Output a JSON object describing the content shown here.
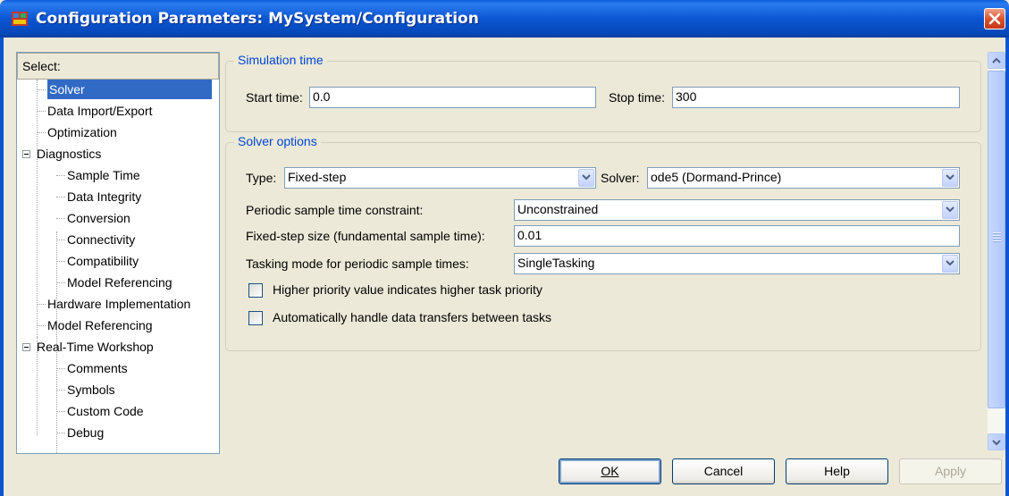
{
  "window": {
    "title": "Configuration Parameters: MySystem/Configuration",
    "colors": {
      "titlebar": "#0a55d2",
      "accent": "#316ac5",
      "group_title": "#0046d5"
    }
  },
  "tree": {
    "header": "Select:",
    "items": [
      {
        "label": "Solver",
        "selected": true
      },
      {
        "label": "Data Import/Export"
      },
      {
        "label": "Optimization"
      },
      {
        "label": "Diagnostics",
        "expanded": true
      },
      {
        "label": "Sample Time"
      },
      {
        "label": "Data Integrity"
      },
      {
        "label": "Conversion"
      },
      {
        "label": "Connectivity"
      },
      {
        "label": "Compatibility"
      },
      {
        "label": "Model Referencing"
      },
      {
        "label": "Hardware Implementation"
      },
      {
        "label": "Model Referencing"
      },
      {
        "label": "Real-Time Workshop",
        "expanded": true
      },
      {
        "label": "Comments"
      },
      {
        "label": "Symbols"
      },
      {
        "label": "Custom Code"
      },
      {
        "label": "Debug"
      }
    ]
  },
  "simulation_time": {
    "title": "Simulation time",
    "start_label": "Start time:",
    "start_value": "0.0",
    "stop_label": "Stop time:",
    "stop_value": "300"
  },
  "solver_options": {
    "title": "Solver options",
    "type_label": "Type:",
    "type_value": "Fixed-step",
    "solver_label": "Solver:",
    "solver_value": "ode5 (Dormand-Prince)",
    "periodic_label": "Periodic sample time constraint:",
    "periodic_value": "Unconstrained",
    "step_label": "Fixed-step size (fundamental sample time):",
    "step_value": "0.01",
    "tasking_label": "Tasking mode for periodic sample times:",
    "tasking_value": "SingleTasking",
    "check1_label": "Higher priority value indicates higher task priority",
    "check1_checked": false,
    "check2_label": "Automatically handle data transfers between tasks",
    "check2_checked": false
  },
  "buttons": {
    "ok_label": "OK",
    "cancel_label": "Cancel",
    "help_label": "Help",
    "apply_label": "Apply"
  },
  "icons": [
    "app-icon",
    "close-icon",
    "scroll-up-icon",
    "scroll-down-icon",
    "tree-collapse-icon",
    "combo-arrow-icon"
  ]
}
